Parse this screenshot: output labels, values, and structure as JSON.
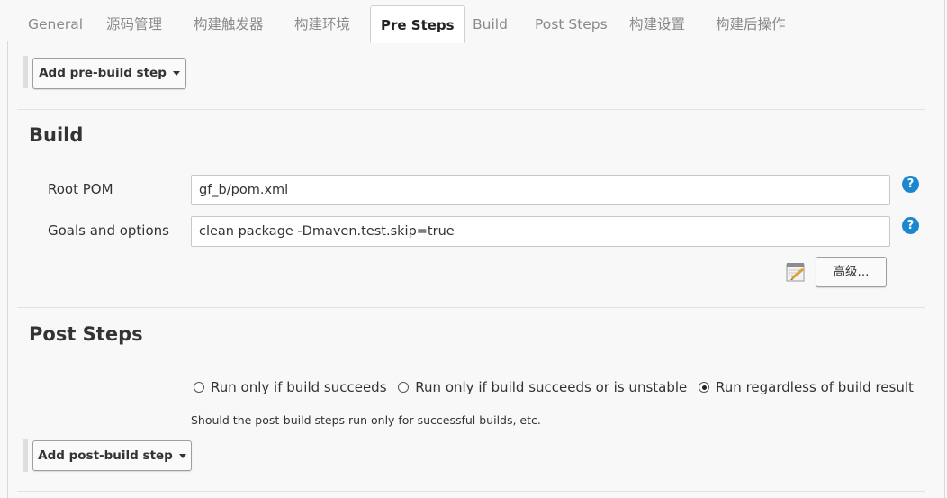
{
  "tabs": [
    {
      "label": "General",
      "active": false
    },
    {
      "label": "源码管理",
      "active": false
    },
    {
      "label": "构建触发器",
      "active": false
    },
    {
      "label": "构建环境",
      "active": false
    },
    {
      "label": "Pre Steps",
      "active": true
    },
    {
      "label": "Build",
      "active": false
    },
    {
      "label": "Post Steps",
      "active": false
    },
    {
      "label": "构建设置",
      "active": false
    },
    {
      "label": "构建后操作",
      "active": false
    }
  ],
  "pre_steps": {
    "add_button_label": "Add pre-build step"
  },
  "build": {
    "title": "Build",
    "root_pom_label": "Root POM",
    "root_pom_value": "gf_b/pom.xml",
    "goals_label": "Goals and options",
    "goals_value": "clean package -Dmaven.test.skip=true",
    "advanced_button_label": "高级...",
    "help_glyph": "?"
  },
  "post_steps": {
    "title": "Post Steps",
    "radio_options": [
      {
        "label": "Run only if build succeeds",
        "checked": false
      },
      {
        "label": "Run only if build succeeds or is unstable",
        "checked": false
      },
      {
        "label": "Run regardless of build result",
        "checked": true
      }
    ],
    "help_text": "Should the post-build steps run only for successful builds, etc.",
    "add_button_label": "Add post-build step"
  },
  "icons": {
    "help": "help-icon",
    "notepad": "notepad-icon",
    "caret": "caret-down-icon"
  },
  "colors": {
    "help_icon": "#1a87d0",
    "active_tab_bg": "#ffffff",
    "page_bg": "#f8f8f8"
  }
}
